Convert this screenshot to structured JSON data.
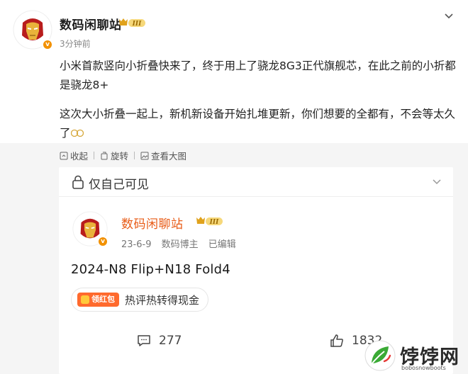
{
  "post": {
    "author": "数码闲聊站",
    "rank_badge": "III",
    "time": "3分钟前",
    "paragraph1": "小米首款竖向小折叠快来了，终于用上了骁龙8G3正代旗舰芯，在此之前的小折都是骁龙8+",
    "paragraph2": "这次大小折叠一起上，新机新设备开始扎堆更新，你们想要的全都有，不会等太久了",
    "emoji": "sweat-smile-emoji"
  },
  "toolbar": {
    "collapse": "收起",
    "rotate": "旋转",
    "view_large": "查看大图"
  },
  "repost": {
    "visibility": "仅自己可见",
    "author": "数码闲聊站",
    "rank_badge": "III",
    "date": "23-6-9",
    "role": "数码博主",
    "edited": "已编辑",
    "text": "2024-N8 Flip+N18 Fold4",
    "promo_badge": "领红包",
    "promo_text": "热评热转得现金",
    "comments": "277",
    "likes": "1832"
  },
  "watermark": {
    "name": "饽饽网",
    "url": "bobosnowboots"
  },
  "colors": {
    "accent_orange": "#e85b16",
    "badge_gold": "#f29100",
    "grey_bg": "#f5f5f5"
  }
}
